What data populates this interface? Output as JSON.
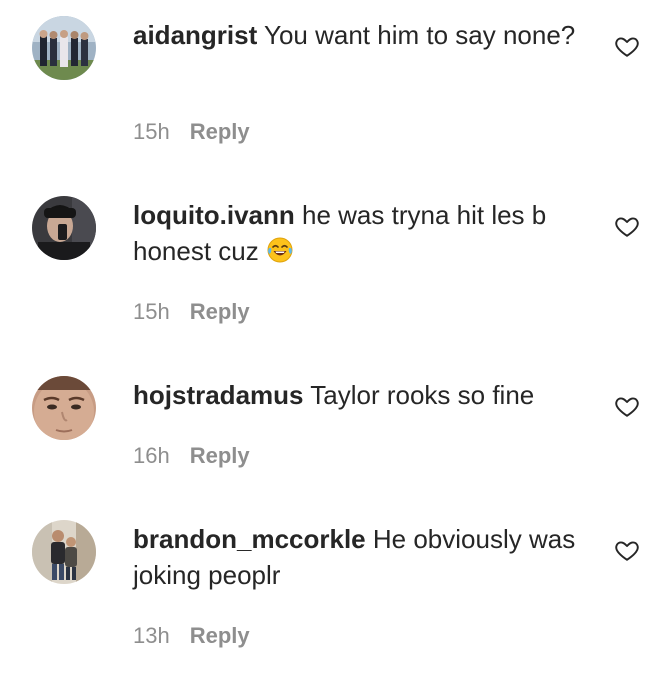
{
  "comments": [
    {
      "username": "aidangrist",
      "text": "You want him to say none?",
      "time": "15h",
      "reply_label": "Reply",
      "avatar_icon": "group-photo-avatar",
      "like_icon": "heart-outline-icon"
    },
    {
      "username": "loquito.ivann",
      "text": "he was tryna hit les b honest cuz",
      "emoji": "😂",
      "time": "15h",
      "reply_label": "Reply",
      "avatar_icon": "selfie-avatar",
      "like_icon": "heart-outline-icon"
    },
    {
      "username": "hojstradamus",
      "text": "Taylor rooks so fine",
      "time": "16h",
      "reply_label": "Reply",
      "avatar_icon": "face-closeup-avatar",
      "like_icon": "heart-outline-icon"
    },
    {
      "username": "brandon_mccorkle",
      "text": "He obviously was joking peoplr",
      "time": "13h",
      "reply_label": "Reply",
      "avatar_icon": "two-people-avatar",
      "like_icon": "heart-outline-icon"
    }
  ],
  "colors": {
    "text": "#262626",
    "secondary": "#8e8e8e"
  }
}
